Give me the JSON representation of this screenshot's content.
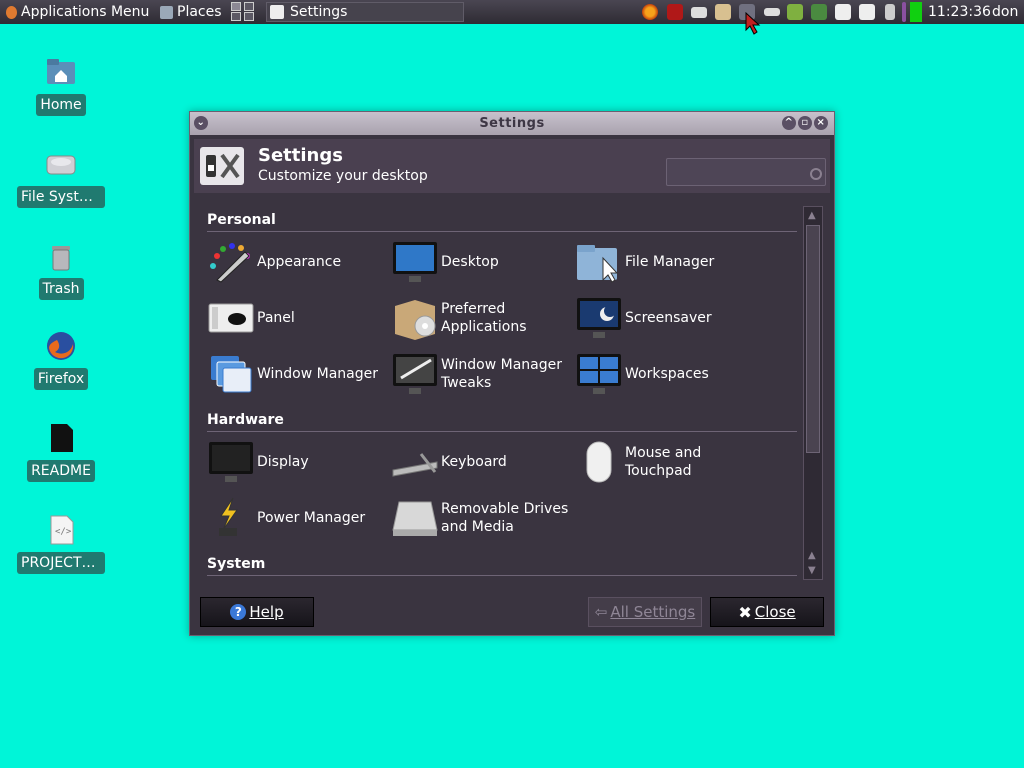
{
  "panel": {
    "apps_menu": "Applications Menu",
    "places": "Places",
    "task_title": "Settings",
    "clock": "11:23:36",
    "user": "don"
  },
  "desktop": {
    "icons": [
      {
        "label": "Home",
        "icon": "home-folder-icon"
      },
      {
        "label": "File System",
        "icon": "hard-drive-icon"
      },
      {
        "label": "Trash",
        "icon": "trash-icon"
      },
      {
        "label": "Firefox",
        "icon": "firefox-icon"
      },
      {
        "label": "README",
        "icon": "document-icon"
      },
      {
        "label": "PROJECTS...",
        "icon": "html-file-icon"
      }
    ]
  },
  "window": {
    "title": "Settings",
    "header_title": "Settings",
    "header_subtitle": "Customize your desktop",
    "search_placeholder": "",
    "sections": {
      "personal": "Personal",
      "hardware": "Hardware",
      "system": "System"
    },
    "items": {
      "appearance": "Appearance",
      "desktop": "Desktop",
      "file_manager": "File Manager",
      "panel": "Panel",
      "preferred_1": "Preferred",
      "preferred_2": "Applications",
      "screensaver": "Screensaver",
      "window_manager": "Window Manager",
      "wm_tweaks_1": "Window Manager",
      "wm_tweaks_2": "Tweaks",
      "workspaces": "Workspaces",
      "display": "Display",
      "keyboard": "Keyboard",
      "mouse_1": "Mouse and",
      "mouse_2": "Touchpad",
      "power_manager": "Power Manager",
      "removable_1": "Removable Drives",
      "removable_2": "and Media"
    },
    "buttons": {
      "help": "Help",
      "all_settings": "All Settings",
      "close": "Close"
    }
  },
  "colors": {
    "desktop_bg": "#00f5d8",
    "window_bg": "#3a3440",
    "label_bg": "#207a70"
  }
}
